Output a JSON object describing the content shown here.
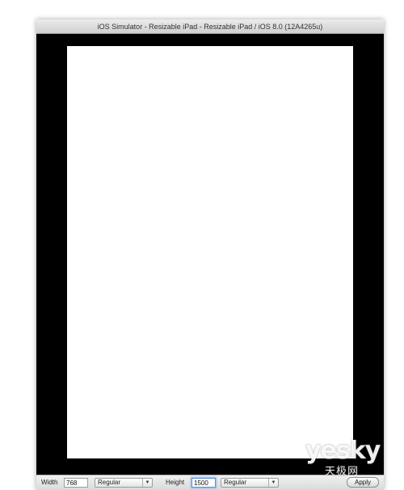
{
  "window": {
    "title": "iOS Simulator - Resizable iPad - Resizable iPad / iOS 8.0 (12A4265u)"
  },
  "colors": {
    "bezel": "#000000",
    "screen": "#ffffff",
    "focus_ring": "#5c8fd6"
  },
  "bottom_bar": {
    "width_label": "Width",
    "width_value": "768",
    "width_class": "Regular",
    "height_label": "Height",
    "height_value": "1500",
    "height_class": "Regular",
    "apply_label": "Apply",
    "dropdown_icon": "chevron-down-icon"
  },
  "watermark": {
    "main": "yesky",
    "sub": "天极网"
  }
}
